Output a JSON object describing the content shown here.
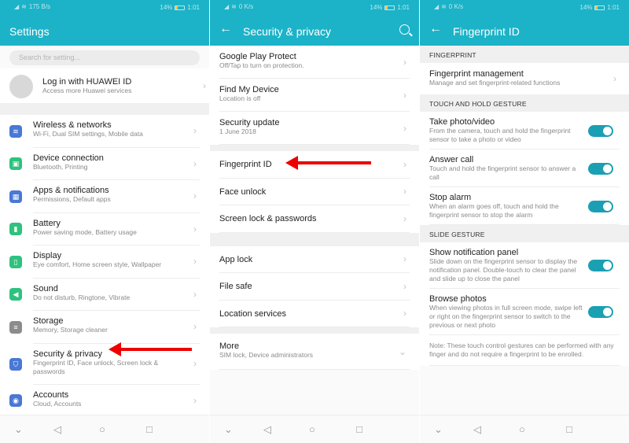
{
  "status": {
    "battery": "14%",
    "time": "1:01",
    "speed1": "175 B/s",
    "speed2": "0 K/s"
  },
  "screen1": {
    "title": "Settings",
    "search_placeholder": "Search for setting...",
    "account": {
      "label": "Log in with HUAWEI ID",
      "sub": "Access more Huawei services"
    },
    "items": [
      {
        "label": "Wireless & networks",
        "sub": "Wi-Fi, Dual SIM settings, Mobile data",
        "icon": "wifi-icon",
        "color": "#4a78d4"
      },
      {
        "label": "Device connection",
        "sub": "Bluetooth, Printing",
        "icon": "device-connection-icon",
        "color": "#2ec27e"
      },
      {
        "label": "Apps & notifications",
        "sub": "Permissions, Default apps",
        "icon": "apps-icon",
        "color": "#4a78d4"
      },
      {
        "label": "Battery",
        "sub": "Power saving mode, Battery usage",
        "icon": "battery-icon",
        "color": "#2ec27e"
      },
      {
        "label": "Display",
        "sub": "Eye comfort, Home screen style, Wallpaper",
        "icon": "display-icon",
        "color": "#2ec27e"
      },
      {
        "label": "Sound",
        "sub": "Do not disturb, Ringtone, Vibrate",
        "icon": "sound-icon",
        "color": "#2ec27e"
      },
      {
        "label": "Storage",
        "sub": "Memory, Storage cleaner",
        "icon": "storage-icon",
        "color": "#8c8c8c"
      },
      {
        "label": "Security & privacy",
        "sub": "Fingerprint ID, Face unlock, Screen lock & passwords",
        "icon": "shield-icon",
        "color": "#4a78d4"
      },
      {
        "label": "Accounts",
        "sub": "Cloud, Accounts",
        "icon": "accounts-icon",
        "color": "#4a78d4"
      }
    ]
  },
  "screen2": {
    "title": "Security & privacy",
    "group1": [
      {
        "label": "Google Play Protect",
        "sub": "Off/Tap to turn on protection."
      },
      {
        "label": "Find My Device",
        "sub": "Location is off"
      },
      {
        "label": "Security update",
        "sub": "1 June 2018"
      }
    ],
    "group2": [
      {
        "label": "Fingerprint ID"
      },
      {
        "label": "Face unlock"
      },
      {
        "label": "Screen lock & passwords"
      }
    ],
    "group3": [
      {
        "label": "App lock"
      },
      {
        "label": "File safe"
      },
      {
        "label": "Location services"
      }
    ],
    "more": {
      "label": "More",
      "sub": "SIM lock, Device administrators"
    }
  },
  "screen3": {
    "title": "Fingerprint ID",
    "section1": "FINGERPRINT",
    "management": {
      "label": "Fingerprint management",
      "sub": "Manage and set fingerprint-related functions"
    },
    "section2": "TOUCH AND HOLD GESTURE",
    "touch_items": [
      {
        "label": "Take photo/video",
        "sub": "From the camera, touch and hold the fingerprint sensor to take a photo or video",
        "on": true
      },
      {
        "label": "Answer call",
        "sub": "Touch and hold the fingerprint sensor to answer a call",
        "on": true
      },
      {
        "label": "Stop alarm",
        "sub": "When an alarm goes off, touch and hold the fingerprint sensor to stop the alarm",
        "on": true
      }
    ],
    "section3": "SLIDE GESTURE",
    "slide_items": [
      {
        "label": "Show notification panel",
        "sub": "Slide down on the fingerprint sensor to display the notification panel. Double-touch to clear the panel and slide up to close the panel",
        "on": true
      },
      {
        "label": "Browse photos",
        "sub": "When viewing photos in full screen mode, swipe left or right on the fingerprint sensor to switch to the previous or next photo",
        "on": true
      }
    ],
    "note": "Note: These touch control gestures can be performed with any finger and do not require a fingerprint to be enrolled."
  },
  "colors": {
    "accent": "#1cb3c8",
    "toggle": "#1a9fb3",
    "arrow": "#e00000"
  }
}
